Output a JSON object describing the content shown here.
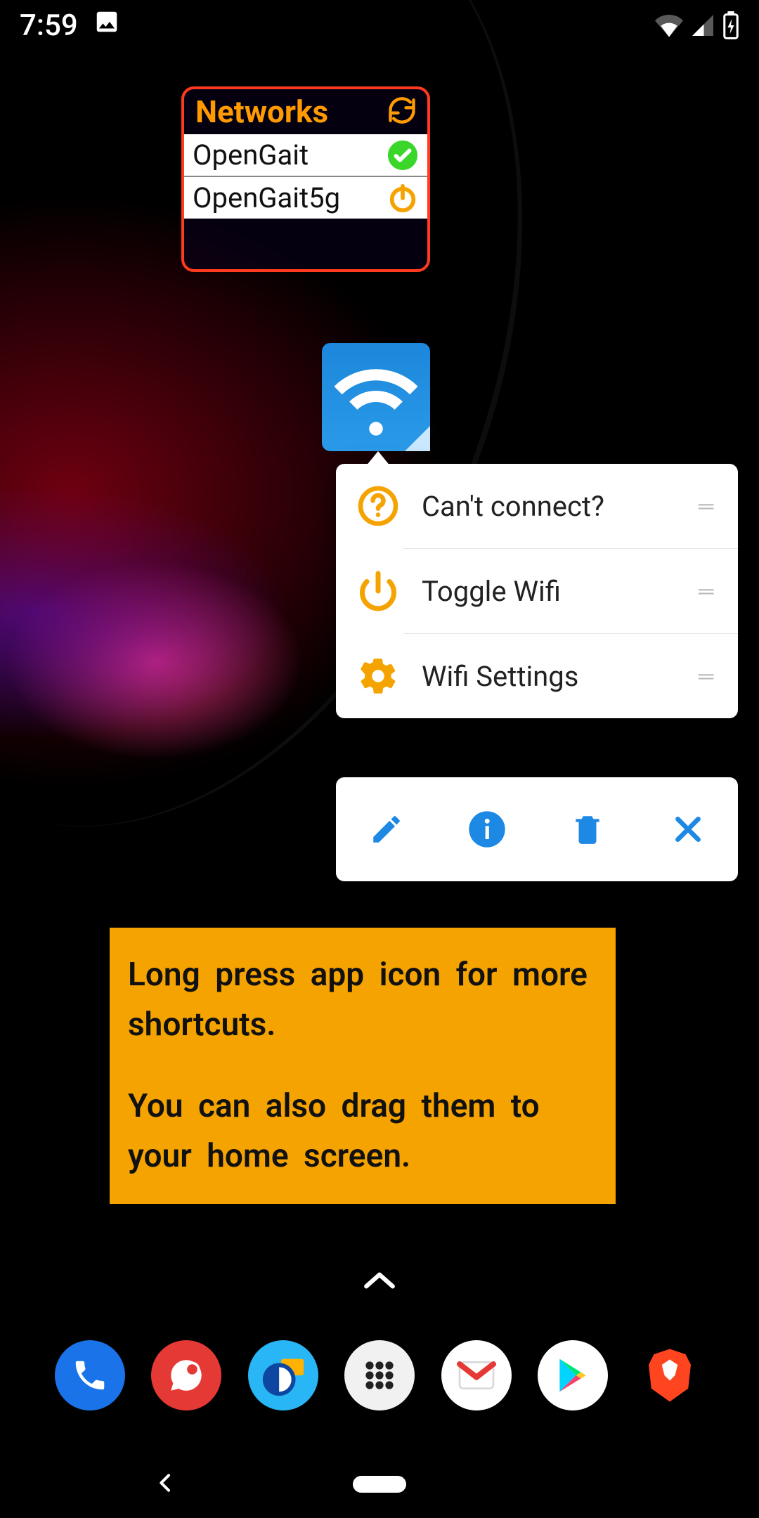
{
  "status": {
    "time": "7:59",
    "icons": {
      "image": "image-icon",
      "wifi": "wifi-icon",
      "signal": "signal-icon",
      "battery": "battery-charging-icon"
    }
  },
  "networks_widget": {
    "title": "Networks",
    "items": [
      {
        "ssid": "OpenGait",
        "status": "connected"
      },
      {
        "ssid": "OpenGait5g",
        "status": "power"
      }
    ]
  },
  "wifi_app": {
    "name": "wifi-app"
  },
  "shortcut_popup": {
    "items": [
      {
        "icon": "help-icon",
        "label": "Can't connect?"
      },
      {
        "icon": "power-icon",
        "label": "Toggle Wifi"
      },
      {
        "icon": "settings-icon",
        "label": "Wifi Settings"
      }
    ]
  },
  "action_bar": {
    "actions": [
      {
        "name": "edit-icon"
      },
      {
        "name": "info-icon"
      },
      {
        "name": "delete-icon"
      },
      {
        "name": "close-icon"
      }
    ]
  },
  "tip": {
    "line1": "Long press app icon for more shortcuts.",
    "line2": "You can also drag them to your home screen."
  },
  "dock": {
    "items": [
      {
        "name": "phone-app"
      },
      {
        "name": "messages-app"
      },
      {
        "name": "swipe-app"
      },
      {
        "name": "app-drawer"
      },
      {
        "name": "gmail-app"
      },
      {
        "name": "play-store-app"
      },
      {
        "name": "brave-app"
      }
    ]
  }
}
